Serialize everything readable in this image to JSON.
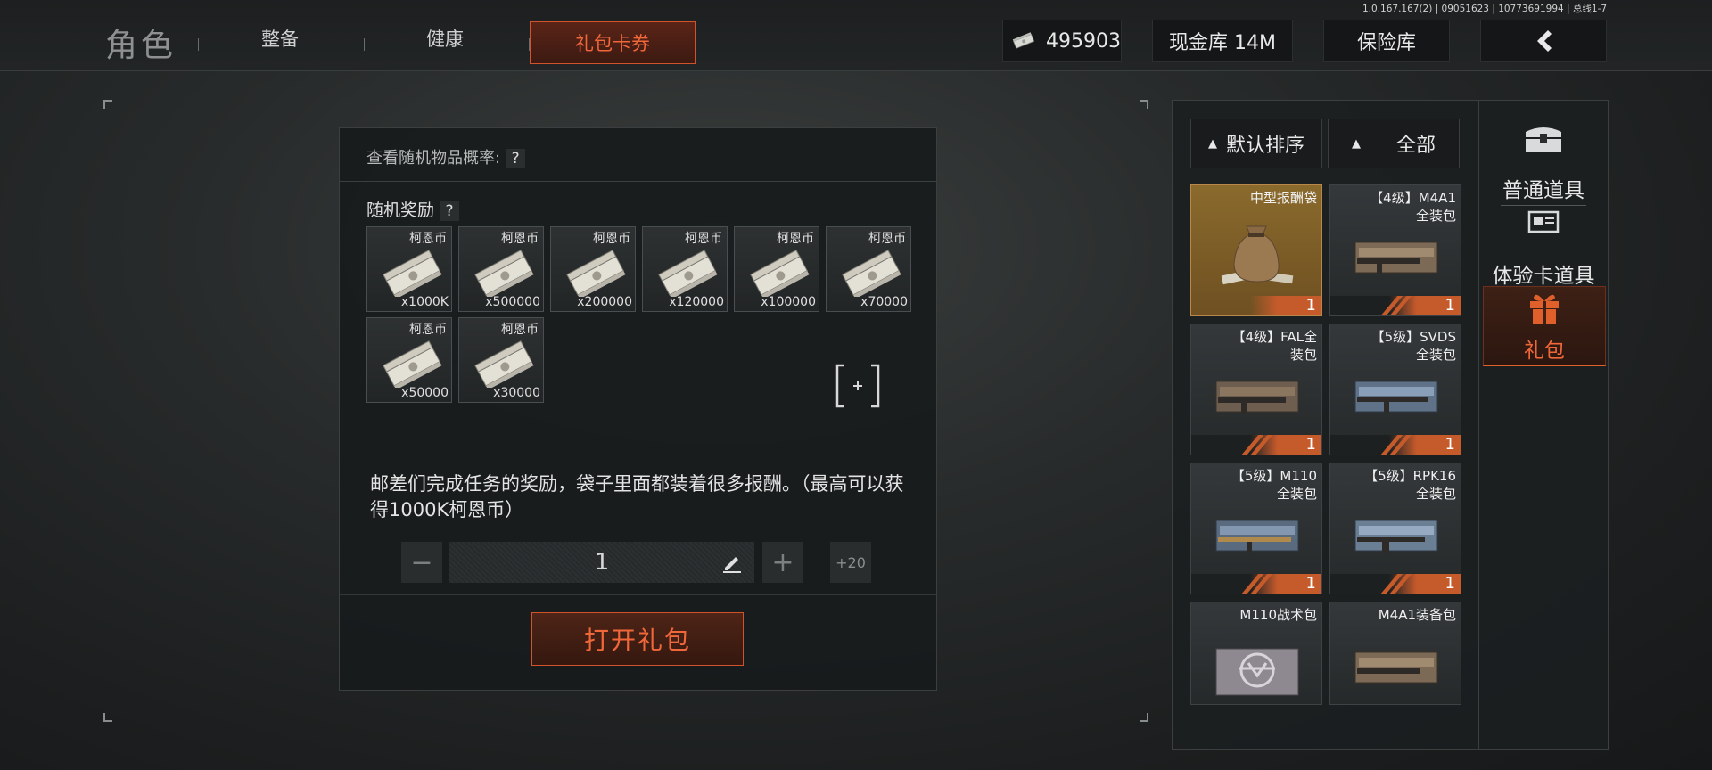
{
  "build_info": "1.0.167.167(2) | 09051623 | 10773691994 | 总线1-7",
  "nav": {
    "title": "角色",
    "tabs": [
      "整备",
      "健康",
      "礼包卡券"
    ],
    "active_tab": "礼包卡券"
  },
  "header": {
    "cash_value": "495903",
    "cash_vault_label": "现金库 14M",
    "safe_label": "保险库",
    "back_icon": "chevron-left-icon"
  },
  "gift_detail": {
    "prob_label": "查看随机物品概率:",
    "help_glyph": "?",
    "rewards_label": "随机奖励",
    "rewards": [
      {
        "name": "柯恩币",
        "qty": "x1000K"
      },
      {
        "name": "柯恩币",
        "qty": "x500000"
      },
      {
        "name": "柯恩币",
        "qty": "x200000"
      },
      {
        "name": "柯恩币",
        "qty": "x120000"
      },
      {
        "name": "柯恩币",
        "qty": "x100000"
      },
      {
        "name": "柯恩币",
        "qty": "x70000"
      },
      {
        "name": "柯恩币",
        "qty": "x50000"
      },
      {
        "name": "柯恩币",
        "qty": "x30000"
      }
    ],
    "description": "邮差们完成任务的奖励，袋子里面都装着很多报酬。（最高可以获得1000K柯恩币）",
    "quantity": "1",
    "minus_glyph": "−",
    "plus_glyph": "+",
    "plus20_label": "+20",
    "open_button": "打开礼包"
  },
  "inventory": {
    "sort_label": "默认排序",
    "filter_label": "全部",
    "items": [
      {
        "name": "中型报酬袋",
        "count": "1",
        "selected": true
      },
      {
        "name": "【4级】M4A1\n全装包",
        "count": "1"
      },
      {
        "name": "【4级】FAL全\n装包",
        "count": "1"
      },
      {
        "name": "【5级】SVDS\n全装包",
        "count": "1"
      },
      {
        "name": "【5级】M110\n全装包",
        "count": "1"
      },
      {
        "name": "【5级】RPK16\n全装包",
        "count": "1"
      },
      {
        "name": "M110战术包",
        "count": ""
      },
      {
        "name": "M4A1装备包",
        "count": ""
      }
    ]
  },
  "categories": [
    {
      "label": "普通道具",
      "icon": "chest-icon"
    },
    {
      "label": "体验卡道具",
      "icon": "card-icon"
    },
    {
      "label": "礼包",
      "icon": "gift-icon",
      "active": true
    }
  ],
  "colors": {
    "accent": "#f0673a",
    "accent_border": "#d0532c",
    "selected_item": "#8a6a2c"
  }
}
